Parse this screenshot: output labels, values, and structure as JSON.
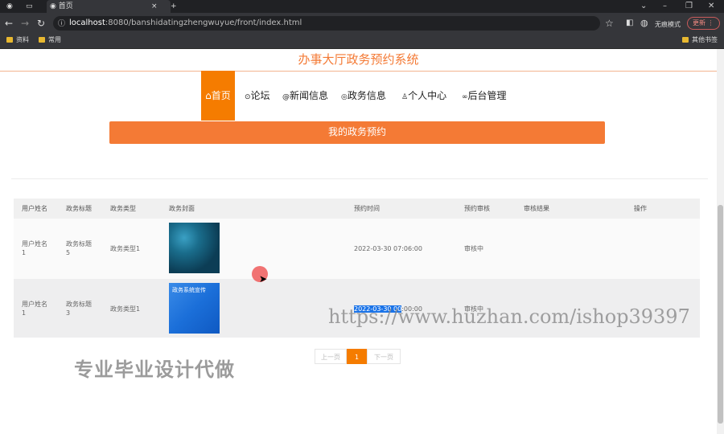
{
  "browser": {
    "tabs": [
      {
        "label": ""
      },
      {
        "label": "首页"
      }
    ],
    "close": "×",
    "new_tab": "+",
    "url_host": "localhost",
    "url_path": ":8080/banshidatingzhengwuyue/front/index.html",
    "incognito": "无痕模式",
    "update": "更新",
    "bookmarks": [
      "资料",
      "常用"
    ],
    "other_bookmarks": "其他书签"
  },
  "site": {
    "title": "办事大厅政务预约系统",
    "nav": [
      {
        "icon": "home-icon",
        "label": "首页"
      },
      {
        "icon": "forum-icon",
        "label": "论坛"
      },
      {
        "icon": "news-icon",
        "label": "新闻信息"
      },
      {
        "icon": "gov-icon",
        "label": "政务信息"
      },
      {
        "icon": "user-icon",
        "label": "个人中心"
      },
      {
        "icon": "link-icon",
        "label": "后台管理"
      }
    ],
    "banner": "我的政务预约"
  },
  "table": {
    "headers": [
      "用户姓名",
      "政务标题",
      "政务类型",
      "政务封面",
      "预约时间",
      "预约审核",
      "审核结果",
      "操作"
    ],
    "rows": [
      {
        "user": "用户姓名\n1",
        "title": "政务标题\n5",
        "type": "政务类型1",
        "time": "2022-03-30 07:06:00",
        "review": "审核中",
        "result": "",
        "action": ""
      },
      {
        "user": "用户姓名\n1",
        "title": "政务标题\n3",
        "type": "政务类型1",
        "time_sel": "2022-03-30 00",
        "time_rest": ":00:00",
        "review": "审核中",
        "result": "",
        "action": "",
        "cover_text": "政务系统宣传"
      }
    ]
  },
  "pager": {
    "prev": "上一页",
    "current": "1",
    "next": "下一页"
  },
  "watermarks": {
    "cn": "专业毕业设计代做",
    "url": "https://www.huzhan.com/ishop39397"
  },
  "colors": {
    "accent": "#f57c00",
    "title": "#f47a35"
  }
}
